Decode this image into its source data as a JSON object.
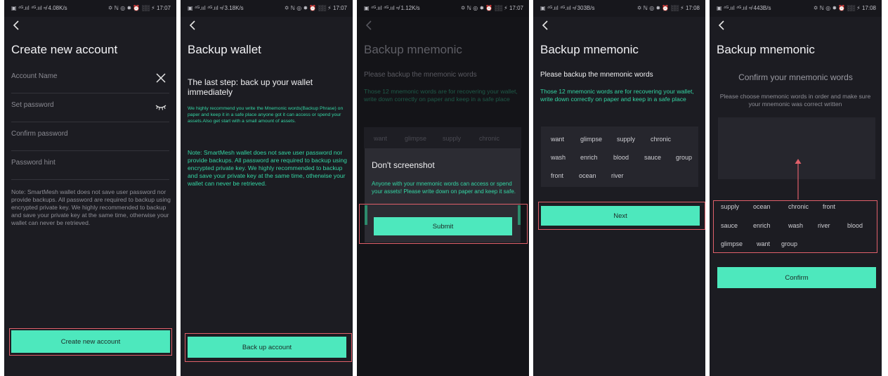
{
  "status_bars": [
    {
      "left": "▣ ⁴ᴳ.ııl ⁴ᴳ.ııl ≉ 4.08K/s",
      "right": "✡ ℕ ◎ ✸ ⏰ ░░ ⚡ 17:07"
    },
    {
      "left": "▣ ⁴ᴳ.ııl ⁴ᴳ.ııl ≉ 3.18K/s",
      "right": "✡ ℕ ◎ ✸ ⏰ ░░ ⚡ 17:07"
    },
    {
      "left": "▣ ⁴ᴳ.ııl ⁴ᴳ.ııl ≉ 1.12K/s",
      "right": "✡ ℕ ◎ ✸ ⏰ ░░ ⚡ 17:07"
    },
    {
      "left": "▣ ⁴ᴳ.ııl ⁴ᴳ.ııl ≉ 303B/s",
      "right": "✡ ℕ ◎ ✸ ⏰ ░░ ⚡ 17:08"
    },
    {
      "left": "▣ ⁴ᴳ.ııl ⁴ᴳ.ııl ≉ 443B/s",
      "right": "✡ ℕ ◎ ✸ ⏰ ░░ ⚡ 17:08"
    }
  ],
  "screen1": {
    "title": "Create new account",
    "fields": {
      "account_name": "Account Name",
      "password": "Set password",
      "confirm": "Confirm password",
      "hint": "Password hint"
    },
    "note": "Note: SmartMesh wallet does not save user password nor provide backups. All password are required to backup using encrypted private key. We highly recommended to backup and save your private key at the same time, otherwise your wallet can never be retrieved.",
    "button": "Create new account"
  },
  "screen2": {
    "title": "Backup wallet",
    "subtitle": "The last step: back up your wallet immediately",
    "recommend": "We highly recommend you write the Mnemonic words(Backup Phrase) on paper and keep it in a safe place anyone got it can access or spend your assets.Also get start with a small amount of assets.",
    "note": "Note: SmartMesh wallet does not save user password nor provide backups. All password are required to backup using encrypted private key. We highly recommended to backup and save your private key at the same time, otherwise your wallet can never be retrieved.",
    "button": "Back up account"
  },
  "screen3": {
    "title": "Backup mnemonic",
    "subtitle": "Please backup the mnemonic words",
    "desc": "Those 12 mnemonic words are for recovering your wallet, write down correctly on paper and keep in a safe place",
    "words_row": [
      "want",
      "glimpse",
      "supply",
      "chronic"
    ],
    "modal_title": "Don't screenshot",
    "modal_text": "Anyone with your mnemonic words can access or spend your assets! Please write down on paper and keep it safe.",
    "modal_button": "Submit"
  },
  "screen4": {
    "title": "Backup mnemonic",
    "subtitle": "Please backup the mnemonic words",
    "desc": "Those 12 mnemonic words are for recovering your wallet, write down correctly on paper and keep in a safe place",
    "words": [
      "want",
      "glimpse",
      "supply",
      "chronic",
      "wash",
      "enrich",
      "blood",
      "sauce",
      "group",
      "front",
      "ocean",
      "river"
    ],
    "button": "Next"
  },
  "screen5": {
    "title": "Backup mnemonic",
    "heading": "Confirm your mnemonic words",
    "instruction": "Please choose mnemonic words in order and make sure your mnemonic was correct written",
    "choices": [
      "supply",
      "ocean",
      "chronic",
      "front",
      "sauce",
      "enrich",
      "wash",
      "river",
      "blood",
      "glimpse",
      "want",
      "group"
    ],
    "button": "Confirm"
  },
  "colors": {
    "accent": "#4de8bd",
    "background": "#1c1c22",
    "highlight": "#e0606a",
    "teal_text": "#34d6a4"
  }
}
